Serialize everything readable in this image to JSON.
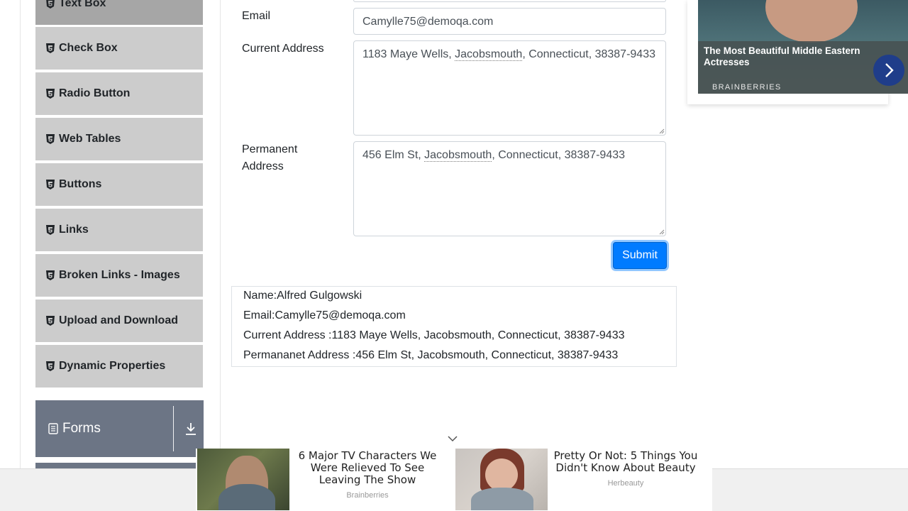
{
  "sidebar": {
    "items": [
      {
        "label": "Text Box"
      },
      {
        "label": "Check Box"
      },
      {
        "label": "Radio Button"
      },
      {
        "label": "Web Tables"
      },
      {
        "label": "Buttons"
      },
      {
        "label": "Links"
      },
      {
        "label": "Broken Links - Images"
      },
      {
        "label": "Upload and Download"
      },
      {
        "label": "Dynamic Properties"
      }
    ],
    "group": {
      "label": "Forms",
      "icon": "form-icon",
      "toggle_icon": "download-arrow-icon"
    }
  },
  "form": {
    "email_label": "Email",
    "email_value": "Camylle75@demoqa.com",
    "current_address_label": "Current Address",
    "current_address_value": {
      "pre": "1183 Maye Wells, ",
      "mark": "Jacobsmouth",
      "post": ", Connecticut, 38387-9433"
    },
    "permanent_address_label_1": "Permanent",
    "permanent_address_label_2": "Address",
    "permanent_address_value": {
      "pre": "456 Elm St, ",
      "mark": "Jacobsmouth",
      "post": ", Connecticut, 38387-9433"
    },
    "submit_label": "Submit"
  },
  "output": {
    "name": "Name:Alfred Gulgowski",
    "email": "Email:Camylle75@demoqa.com",
    "current_address": "Current Address :1183 Maye Wells, Jacobsmouth, Connecticut, 38387-9433",
    "permanent_address": "Permananet Address :456 Elm St, Jacobsmouth, Connecticut, 38387-9433"
  },
  "side_ad": {
    "title": "The Most Beautiful Middle Eastern Actresses",
    "source": "BRAINBERRIES",
    "next_icon": "chevron-right-icon"
  },
  "bottom_ad": {
    "items": [
      {
        "text": "6 Major TV Characters We Were Relieved To See Leaving The Show",
        "brand": "Brainberries"
      },
      {
        "text": "Pretty Or Not: 5 Things You Didn't Know About Beauty",
        "brand": "Herbeauty"
      }
    ],
    "collapse_icon": "chevron-down-icon"
  },
  "colors": {
    "menu_bg": "#cccccc",
    "menu_active_bg": "#a6a6a6",
    "group_bg": "#6c7585",
    "primary": "#007bff"
  }
}
